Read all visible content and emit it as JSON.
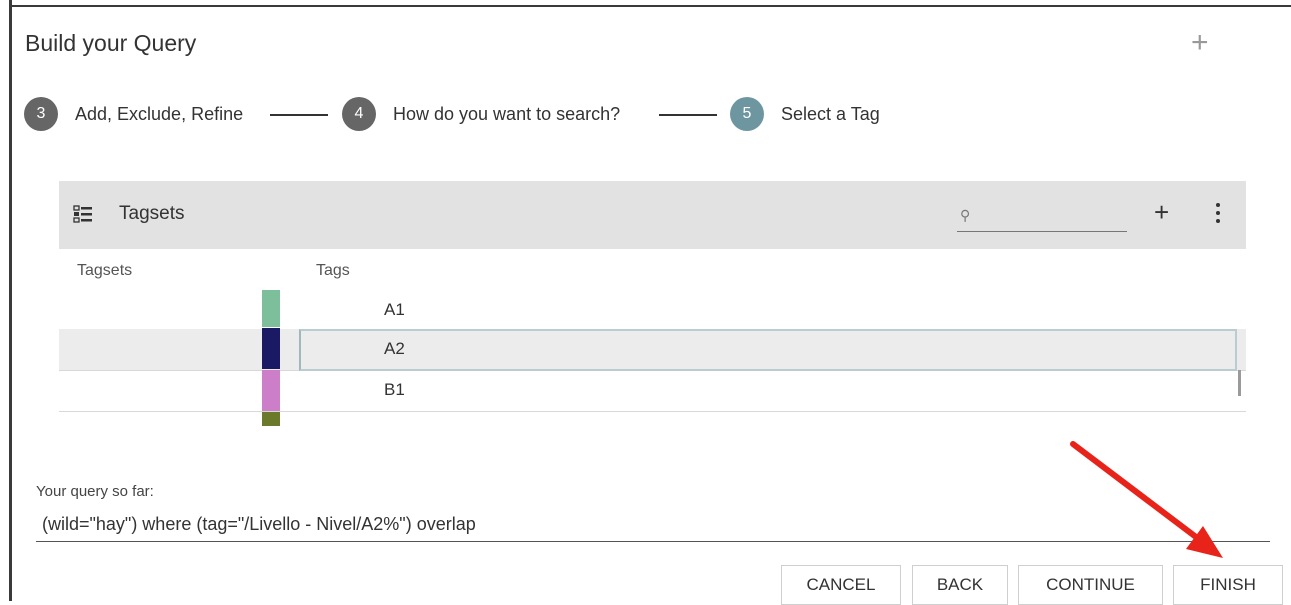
{
  "dialog": {
    "title": "Build your Query",
    "add_symbol": "+"
  },
  "steps": [
    {
      "number": "3",
      "label": "Add, Exclude, Refine",
      "color": "#666666"
    },
    {
      "number": "4",
      "label": "How do you want to search?",
      "color": "#666666"
    },
    {
      "number": "5",
      "label": "Select a Tag",
      "color": "#6e96a1"
    }
  ],
  "tagsets_panel": {
    "title": "Tagsets",
    "icon": "list-icon",
    "search_placeholder": "",
    "search_icon": "search-icon",
    "add_symbol": "+",
    "more_icon": "more-vertical-icon",
    "column_tagsets": "Tagsets",
    "column_tags": "Tags",
    "rows": [
      {
        "tag": "A1",
        "color": "#7dbf9a",
        "selected": false
      },
      {
        "tag": "A2",
        "color": "#1a1a64",
        "selected": true
      },
      {
        "tag": "B1",
        "color": "#cc7ec8",
        "selected": false
      }
    ],
    "partial_swatch_color": "#6b7a2a"
  },
  "query": {
    "label": "Your query so far:",
    "text": "(wild=\"hay\") where (tag=\"/Livello - Nivel/A2%\") overlap"
  },
  "buttons": {
    "cancel": "CANCEL",
    "back": "BACK",
    "continue": "CONTINUE",
    "finish": "FINISH"
  },
  "annotation": {
    "arrow_color": "#e8231a"
  }
}
